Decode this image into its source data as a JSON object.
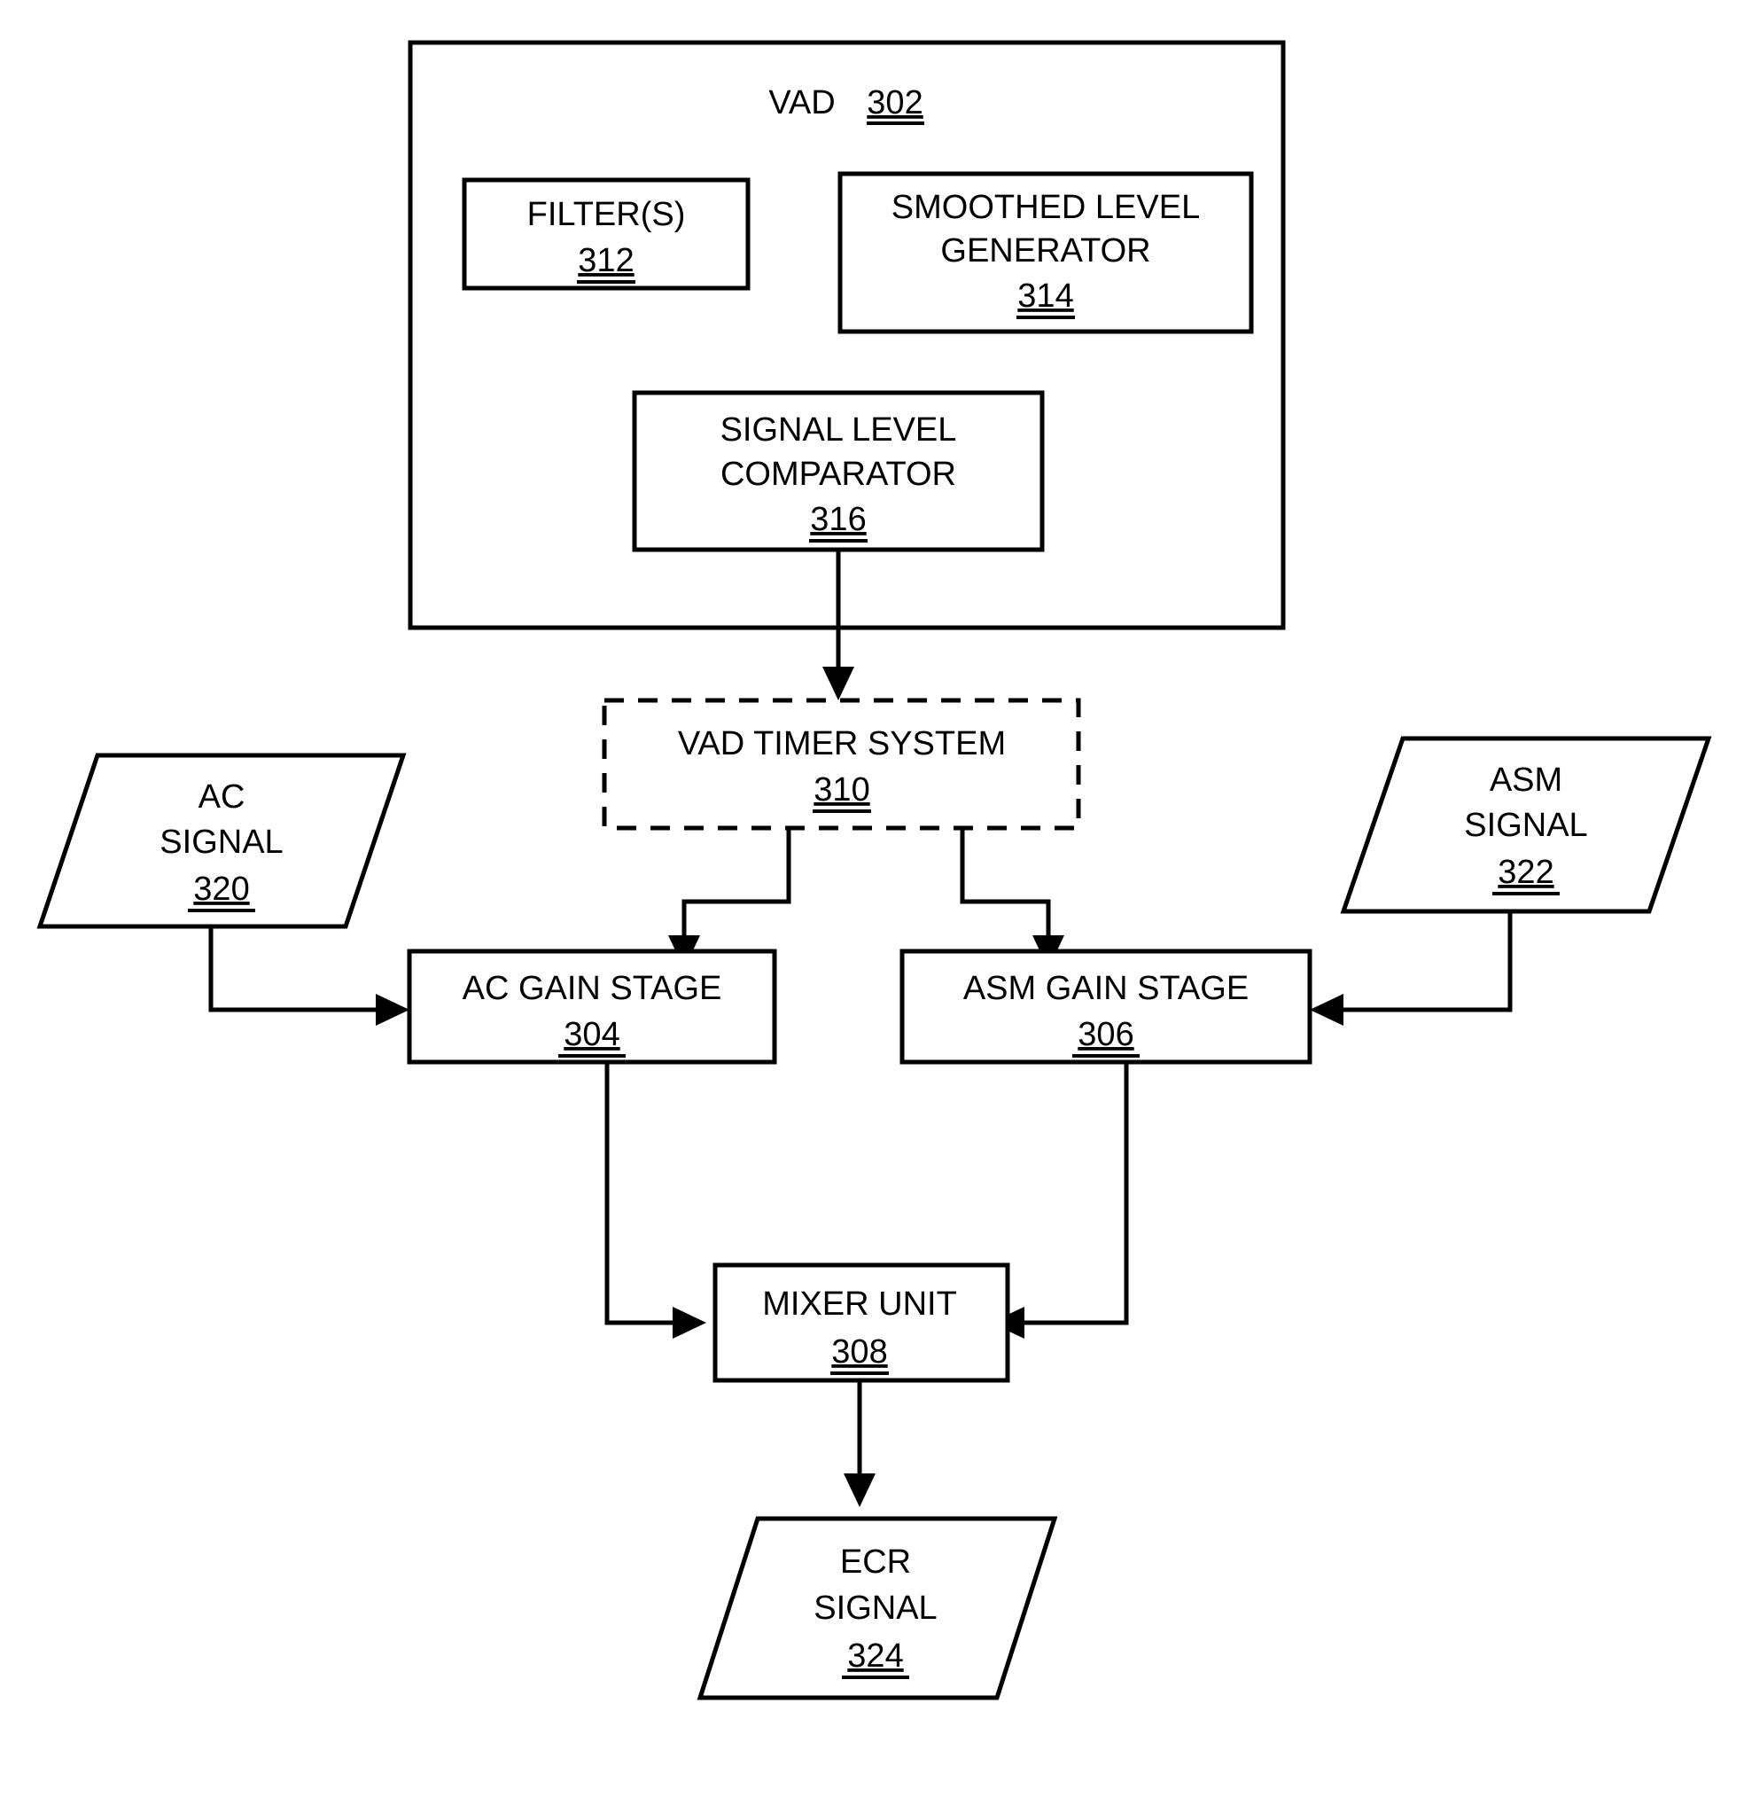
{
  "figure": {
    "type": "block-diagram",
    "title_block": {
      "name": "vad-container",
      "label": "VAD",
      "ref": "302",
      "shape": "rectangle",
      "border": "solid"
    },
    "blocks": [
      {
        "id": "filters",
        "lines": [
          "FILTER(S)"
        ],
        "ref": "312",
        "shape": "rectangle",
        "border": "solid"
      },
      {
        "id": "smoothed-level-generator",
        "lines": [
          "SMOOTHED LEVEL",
          "GENERATOR"
        ],
        "ref": "314",
        "shape": "rectangle",
        "border": "solid"
      },
      {
        "id": "signal-level-comparator",
        "lines": [
          "SIGNAL LEVEL",
          "COMPARATOR"
        ],
        "ref": "316",
        "shape": "rectangle",
        "border": "solid"
      },
      {
        "id": "vad-timer-system",
        "lines": [
          "VAD TIMER SYSTEM"
        ],
        "ref": "310",
        "shape": "rectangle",
        "border": "dashed"
      },
      {
        "id": "ac-signal",
        "lines": [
          "AC",
          "SIGNAL"
        ],
        "ref": "320",
        "shape": "parallelogram",
        "border": "solid"
      },
      {
        "id": "asm-signal",
        "lines": [
          "ASM",
          "SIGNAL"
        ],
        "ref": "322",
        "shape": "parallelogram",
        "border": "solid"
      },
      {
        "id": "ac-gain-stage",
        "lines": [
          "AC GAIN STAGE"
        ],
        "ref": "304",
        "shape": "rectangle",
        "border": "solid"
      },
      {
        "id": "asm-gain-stage",
        "lines": [
          "ASM GAIN STAGE"
        ],
        "ref": "306",
        "shape": "rectangle",
        "border": "solid"
      },
      {
        "id": "mixer-unit",
        "lines": [
          "MIXER UNIT"
        ],
        "ref": "308",
        "shape": "rectangle",
        "border": "solid"
      },
      {
        "id": "ecr-signal",
        "lines": [
          "ECR",
          "SIGNAL"
        ],
        "ref": "324",
        "shape": "parallelogram",
        "border": "solid"
      }
    ],
    "connections": [
      {
        "from": "signal-level-comparator",
        "to": "vad-timer-system",
        "arrow": "down"
      },
      {
        "from": "vad-timer-system",
        "to": "ac-gain-stage",
        "arrow": "down"
      },
      {
        "from": "vad-timer-system",
        "to": "asm-gain-stage",
        "arrow": "down"
      },
      {
        "from": "ac-signal",
        "to": "ac-gain-stage",
        "arrow": "right"
      },
      {
        "from": "asm-signal",
        "to": "asm-gain-stage",
        "arrow": "left"
      },
      {
        "from": "ac-gain-stage",
        "to": "mixer-unit",
        "arrow": "right"
      },
      {
        "from": "asm-gain-stage",
        "to": "mixer-unit",
        "arrow": "left"
      },
      {
        "from": "mixer-unit",
        "to": "ecr-signal",
        "arrow": "down"
      }
    ],
    "colors": {
      "stroke": "#000000",
      "fill": "#ffffff",
      "text": "#000000"
    }
  },
  "labels": {
    "vad_name": "VAD",
    "vad_ref": "302",
    "filters_l1": "FILTER(S)",
    "filters_ref": "312",
    "slg_l1": "SMOOTHED LEVEL",
    "slg_l2": "GENERATOR",
    "slg_ref": "314",
    "slc_l1": "SIGNAL LEVEL",
    "slc_l2": "COMPARATOR",
    "slc_ref": "316",
    "timer_l1": "VAD TIMER SYSTEM",
    "timer_ref": "310",
    "ac_l1": "AC",
    "ac_l2": "SIGNAL",
    "ac_ref": "320",
    "asm_l1": "ASM",
    "asm_l2": "SIGNAL",
    "asm_ref": "322",
    "acgain_l1": "AC GAIN STAGE",
    "acgain_ref": "304",
    "asmgain_l1": "ASM GAIN STAGE",
    "asmgain_ref": "306",
    "mixer_l1": "MIXER UNIT",
    "mixer_ref": "308",
    "ecr_l1": "ECR",
    "ecr_l2": "SIGNAL",
    "ecr_ref": "324"
  }
}
